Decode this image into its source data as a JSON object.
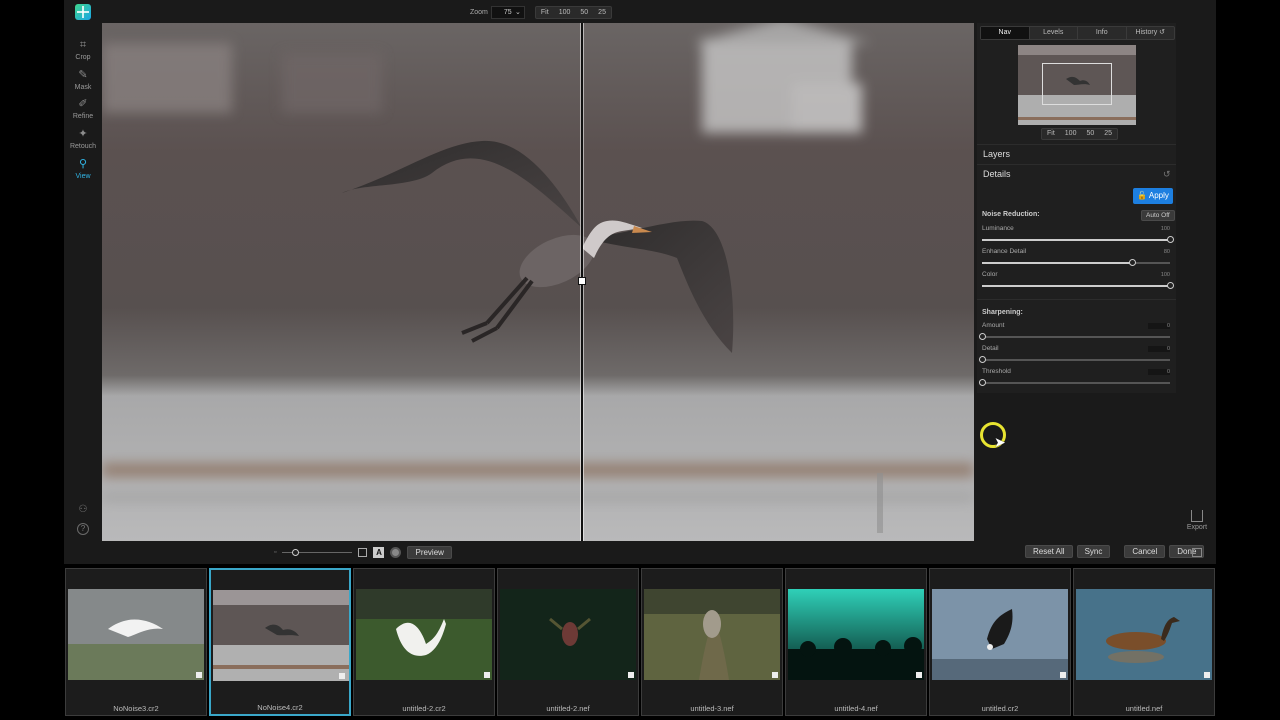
{
  "toolbar": {
    "tools": [
      {
        "label": "Crop",
        "icon": "crop-icon"
      },
      {
        "label": "Mask",
        "icon": "mask-icon"
      },
      {
        "label": "Refine",
        "icon": "refine-icon"
      },
      {
        "label": "Retouch",
        "icon": "retouch-icon"
      },
      {
        "label": "View",
        "icon": "view-icon",
        "active": true
      }
    ],
    "accent_color": "#31b6e7"
  },
  "zoom": {
    "label": "Zoom",
    "value": "75",
    "presets": [
      "Fit",
      "100",
      "50",
      "25"
    ]
  },
  "panel": {
    "tabs": [
      "Nav",
      "Levels",
      "Info",
      "History"
    ],
    "active_tab": "Nav",
    "nav_presets": [
      "Fit",
      "100",
      "50",
      "25"
    ],
    "layers_title": "Layers",
    "details_title": "Details",
    "apply_label": "Apply",
    "apply_color": "#1d7fe0",
    "noise_reduction": {
      "title": "Noise Reduction:",
      "auto_label": "Auto Off",
      "sliders": [
        {
          "label": "Luminance",
          "value": "100",
          "level": 100
        },
        {
          "label": "Enhance Detail",
          "value": "80",
          "level": 80
        },
        {
          "label": "Color",
          "value": "100",
          "level": 100
        }
      ]
    },
    "sharpening": {
      "title": "Sharpening:",
      "sliders": [
        {
          "label": "Amount",
          "value": "0",
          "level": 0
        },
        {
          "label": "Detail",
          "value": "0",
          "level": 0
        },
        {
          "label": "Threshold",
          "value": "0",
          "level": 0
        }
      ]
    }
  },
  "bottom_bar": {
    "preview_label": "Preview",
    "reset_all_label": "Reset All",
    "sync_label": "Sync",
    "cancel_label": "Cancel",
    "done_label": "Done",
    "compare_a_label": "A"
  },
  "export_label": "Export",
  "filmstrip": [
    {
      "name": "NoNoise3.cr2",
      "scene": "egret"
    },
    {
      "name": "NoNoise4.cr2",
      "scene": "heron",
      "selected": true
    },
    {
      "name": "untitled-2.cr2",
      "scene": "goose"
    },
    {
      "name": "untitled-2.nef",
      "scene": "bird-dark"
    },
    {
      "name": "untitled-3.nef",
      "scene": "coyote"
    },
    {
      "name": "untitled-4.nef",
      "scene": "concert"
    },
    {
      "name": "untitled.cr2",
      "scene": "eagle"
    },
    {
      "name": "untitled.nef",
      "scene": "grebe"
    }
  ]
}
